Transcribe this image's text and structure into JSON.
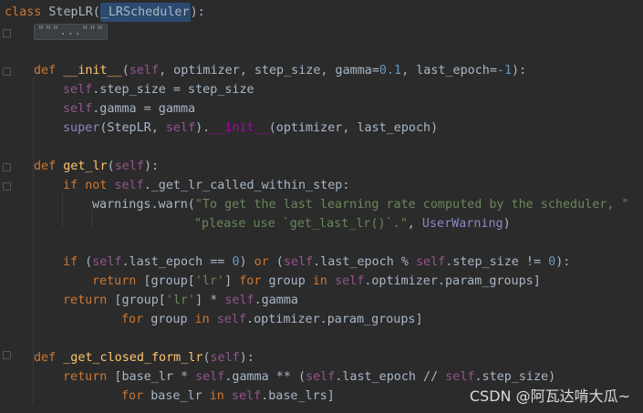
{
  "code": {
    "class_kw": "class",
    "class_name": "StepLR",
    "paren_open": "(",
    "base_class": "_LRScheduler",
    "class_end": "):",
    "docstring_fold": "\"\"\"...\"\"\"",
    "l3": {
      "def": "def",
      "name": "__init__",
      "p1": "(",
      "self": "self",
      "rest1": ", optimizer, step_size, gamma=",
      "num1": "0.1",
      "rest2": ", last_epoch=",
      "num2": "-1",
      "rest3": "):"
    },
    "l4": {
      "self": "self",
      "rest": ".step_size = step_size"
    },
    "l5": {
      "self": "self",
      "rest": ".gamma = gamma"
    },
    "l6": {
      "super": "super",
      "a": "(StepLR, ",
      "self": "self",
      "b": ").",
      "init": "__init__",
      "c": "(optimizer, last_epoch)"
    },
    "l8": {
      "def": "def",
      "name": "get_lr",
      "a": "(",
      "self": "self",
      "b": "):"
    },
    "l9": {
      "if": "if",
      "not": "not",
      "self": "self",
      "rest": "._get_lr_called_within_step:"
    },
    "l10": {
      "a": "warnings.warn(",
      "str": "\"To get the last learning rate computed by the scheduler, \""
    },
    "l11": {
      "str": "\"please use `get_last_lr()`.\"",
      "comma": ", ",
      "warn_cls": "UserWarning",
      "end": ")"
    },
    "l13": {
      "if": "if",
      "a": " (",
      "self1": "self",
      "b": ".last_epoch == ",
      "zero1": "0",
      "c": ") ",
      "or": "or",
      "d": " (",
      "self2": "self",
      "e": ".last_epoch % ",
      "self3": "self",
      "f": ".step_size != ",
      "zero2": "0",
      "g": "):"
    },
    "l14": {
      "return": "return",
      "a": " [group[",
      "str": "'lr'",
      "b": "] ",
      "for": "for",
      "c": " group ",
      "in": "in",
      "d": " ",
      "self": "self",
      "e": ".optimizer.param_groups]"
    },
    "l15": {
      "return": "return",
      "a": " [group[",
      "str": "'lr'",
      "b": "] * ",
      "self": "self",
      "c": ".gamma"
    },
    "l16": {
      "for": "for",
      "a": " group ",
      "in": "in",
      "b": " ",
      "self": "self",
      "c": ".optimizer.param_groups]"
    },
    "l18": {
      "def": "def",
      "name": "_get_closed_form_lr",
      "a": "(",
      "self": "self",
      "b": "):"
    },
    "l19": {
      "return": "return",
      "a": " [base_lr * ",
      "self1": "self",
      "b": ".gamma ** (",
      "self2": "self",
      "c": ".last_epoch // ",
      "self3": "self",
      "d": ".step_size)"
    },
    "l20": {
      "for": "for",
      "a": " base_lr ",
      "in": "in",
      "b": " ",
      "self": "self",
      "c": ".base_lrs]"
    }
  },
  "watermark": "CSDN @阿瓦达啃大瓜~",
  "colors": {
    "background": "#2b2b2b",
    "keyword": "#cc7832",
    "function": "#ffc66d",
    "self": "#94558d",
    "number": "#6897bb",
    "string": "#6a8759",
    "text": "#a9b7c6",
    "magic": "#b200b2"
  }
}
